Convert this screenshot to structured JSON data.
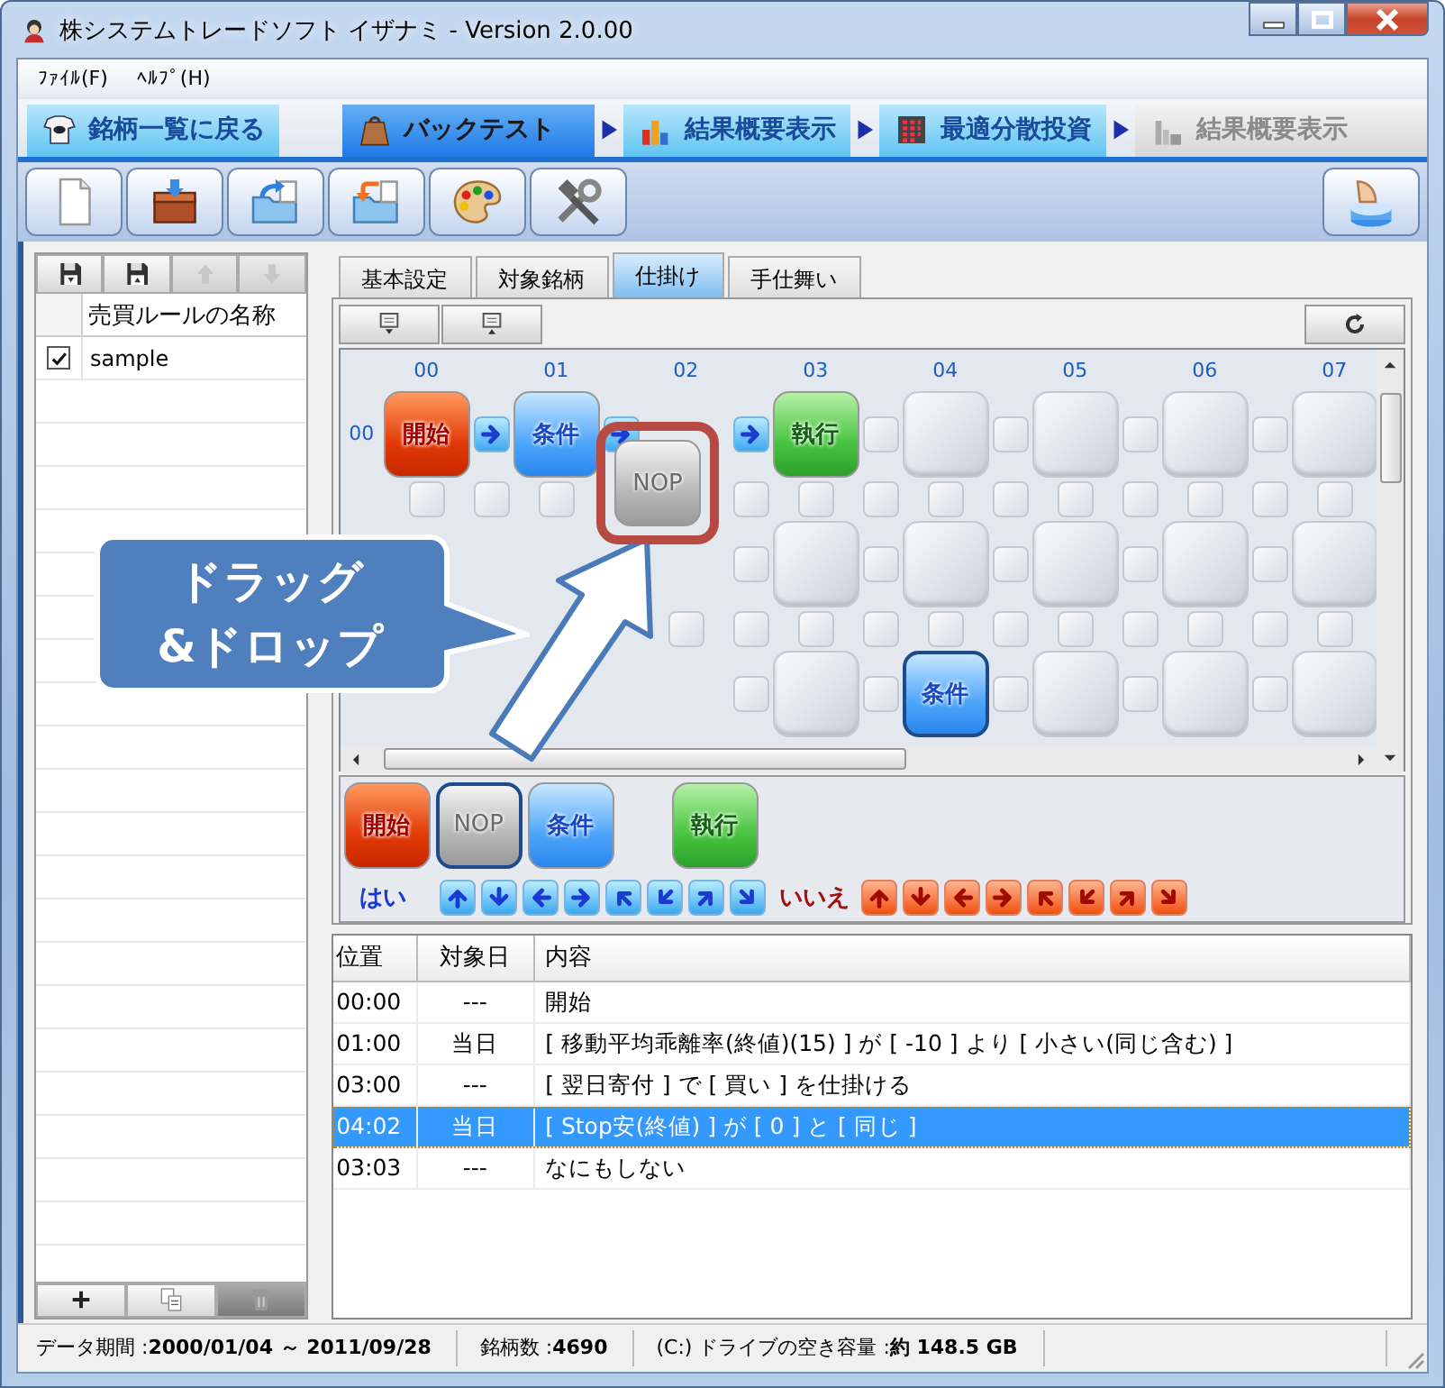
{
  "window": {
    "title": "株システムトレードソフト イザナミ - Version 2.0.00"
  },
  "menu": [
    "ﾌｧｲﾙ(F)",
    "ﾍﾙﾌﾟ(H)"
  ],
  "nav_tabs": [
    {
      "label": "銘柄一覧に戻る",
      "kind": "back",
      "selected": false,
      "disabled": false
    },
    {
      "label": "バックテスト",
      "kind": "step",
      "selected": true,
      "disabled": false
    },
    {
      "label": "結果概要表示",
      "kind": "step",
      "selected": false,
      "disabled": false
    },
    {
      "label": "最適分散投資",
      "kind": "step",
      "selected": false,
      "disabled": false
    },
    {
      "label": "結果概要表示",
      "kind": "step",
      "selected": false,
      "disabled": true
    }
  ],
  "rule_list": {
    "tools": [
      {
        "kind": "save-down",
        "disabled": false
      },
      {
        "kind": "save-up",
        "disabled": false
      },
      {
        "kind": "up",
        "disabled": true
      },
      {
        "kind": "down",
        "disabled": true
      }
    ],
    "column": "売買ルールの名称",
    "rows": [
      {
        "name": "sample",
        "checked": true
      }
    ],
    "actions": [
      {
        "kind": "add",
        "disabled": false
      },
      {
        "kind": "copy",
        "disabled": false
      },
      {
        "kind": "delete",
        "disabled": true
      }
    ]
  },
  "tabs": [
    {
      "label": "基本設定",
      "selected": false
    },
    {
      "label": "対象銘柄",
      "selected": false
    },
    {
      "label": "仕掛け",
      "selected": true
    },
    {
      "label": "手仕舞い",
      "selected": false
    }
  ],
  "grid": {
    "columns": [
      "00",
      "01",
      "02",
      "03",
      "04",
      "05",
      "06",
      "07"
    ],
    "row_labels": [
      "00"
    ],
    "rows": [
      {
        "cells": [
          {
            "kind": "start",
            "label": "開始",
            "selected": false
          },
          {
            "kind": "condition",
            "label": "条件",
            "selected": false
          },
          {
            "kind": "covered"
          },
          {
            "kind": "execute",
            "label": "執行",
            "selected": false
          },
          {
            "kind": "empty"
          },
          {
            "kind": "empty"
          },
          {
            "kind": "empty"
          },
          {
            "kind": "empty"
          }
        ],
        "links": [
          {
            "kind": "arrow-right"
          },
          {
            "kind": "arrow-right"
          },
          {
            "kind": "arrow-right"
          },
          {
            "kind": "empty"
          },
          {
            "kind": "empty"
          },
          {
            "kind": "empty"
          },
          {
            "kind": "empty"
          }
        ],
        "below": [
          {
            "kind": "empty"
          },
          {
            "kind": "empty"
          },
          {
            "kind": "covered"
          },
          {
            "kind": "empty"
          },
          {
            "kind": "empty"
          },
          {
            "kind": "empty"
          },
          {
            "kind": "empty"
          },
          {
            "kind": "empty"
          }
        ],
        "corners": [
          {
            "kind": "empty"
          },
          {
            "kind": "covered"
          },
          {
            "kind": "empty"
          },
          {
            "kind": "empty"
          },
          {
            "kind": "empty"
          },
          {
            "kind": "empty"
          },
          {
            "kind": "empty"
          }
        ]
      },
      {
        "cells": [
          {
            "kind": "covered"
          },
          {
            "kind": "covered"
          },
          {
            "kind": "covered"
          },
          {
            "kind": "empty"
          },
          {
            "kind": "empty"
          },
          {
            "kind": "empty"
          },
          {
            "kind": "empty"
          },
          {
            "kind": "empty"
          }
        ],
        "links": [
          {
            "kind": "covered"
          },
          {
            "kind": "covered"
          },
          {
            "kind": "empty"
          },
          {
            "kind": "empty"
          },
          {
            "kind": "empty"
          },
          {
            "kind": "empty"
          },
          {
            "kind": "empty"
          }
        ],
        "below": [
          {
            "kind": "covered"
          },
          {
            "kind": "covered"
          },
          {
            "kind": "empty"
          },
          {
            "kind": "empty"
          },
          {
            "kind": "empty"
          },
          {
            "kind": "empty"
          },
          {
            "kind": "empty"
          },
          {
            "kind": "empty"
          }
        ],
        "corners": [
          {
            "kind": "covered"
          },
          {
            "kind": "covered"
          },
          {
            "kind": "empty"
          },
          {
            "kind": "empty"
          },
          {
            "kind": "empty"
          },
          {
            "kind": "empty"
          },
          {
            "kind": "empty"
          }
        ]
      },
      {
        "cells": [
          {
            "kind": "covered"
          },
          {
            "kind": "covered"
          },
          {
            "kind": "covered"
          },
          {
            "kind": "empty"
          },
          {
            "kind": "condition",
            "label": "条件",
            "selected": true
          },
          {
            "kind": "empty"
          },
          {
            "kind": "empty"
          },
          {
            "kind": "empty"
          }
        ],
        "links": [
          {
            "kind": "covered"
          },
          {
            "kind": "covered"
          },
          {
            "kind": "empty"
          },
          {
            "kind": "empty"
          },
          {
            "kind": "empty"
          },
          {
            "kind": "empty"
          },
          {
            "kind": "empty"
          }
        ]
      }
    ]
  },
  "drag": {
    "kind": "nop",
    "label": "NOP"
  },
  "callout": {
    "text": "ドラッグ\n&ドロップ"
  },
  "palette": {
    "nodes": [
      {
        "kind": "start",
        "label": "開始",
        "selected": false
      },
      {
        "kind": "nop",
        "label": "NOP",
        "selected": true
      },
      {
        "kind": "condition",
        "label": "条件",
        "selected": false
      },
      {
        "kind": "execute",
        "label": "執行",
        "selected": false
      }
    ],
    "yes_label": "はい",
    "yes_arrows": [
      {
        "kind": "arrow-up"
      },
      {
        "kind": "arrow-down"
      },
      {
        "kind": "arrow-left"
      },
      {
        "kind": "arrow-right"
      },
      {
        "kind": "arrow-up-left"
      },
      {
        "kind": "arrow-down-left"
      },
      {
        "kind": "arrow-up-right"
      },
      {
        "kind": "arrow-down-right"
      }
    ],
    "no_label": "いいえ",
    "no_arrows": [
      {
        "kind": "arrow-up"
      },
      {
        "kind": "arrow-down"
      },
      {
        "kind": "arrow-left"
      },
      {
        "kind": "arrow-right"
      },
      {
        "kind": "arrow-up-left"
      },
      {
        "kind": "arrow-down-left"
      },
      {
        "kind": "arrow-up-right"
      },
      {
        "kind": "arrow-down-right"
      }
    ]
  },
  "steps": {
    "columns": [
      "位置",
      "対象日",
      "内容"
    ],
    "rows": [
      {
        "cells": [
          "00:00",
          "---",
          "開始"
        ],
        "selected": false
      },
      {
        "cells": [
          "01:00",
          "当日",
          "[ 移動平均乖離率(終値)(15) ] が [ -10 ] より [ 小さい(同じ含む) ]"
        ],
        "selected": false
      },
      {
        "cells": [
          "03:00",
          "---",
          "[ 翌日寄付 ] で [ 買い ] を仕掛ける"
        ],
        "selected": false
      },
      {
        "cells": [
          "04:02",
          "当日",
          "[ Stop安(終値) ] が [ 0 ] と [ 同じ ]"
        ],
        "selected": true
      },
      {
        "cells": [
          "03:03",
          "---",
          "なにもしない"
        ],
        "selected": false
      }
    ]
  },
  "status_bar": [
    "データ期間 :**2000/01/04 ～ 2011/09/28**",
    "銘柄数 :**4690**",
    "(C:) ドライブの空き容量 :**約 148.5 GB**"
  ]
}
